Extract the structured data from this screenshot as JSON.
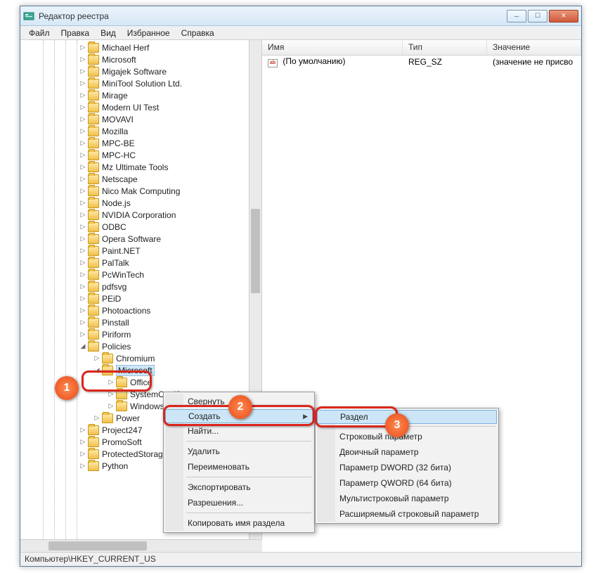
{
  "window": {
    "title": "Редактор реестра"
  },
  "menu": {
    "file": "Файл",
    "edit": "Правка",
    "view": "Вид",
    "favorites": "Избранное",
    "help": "Справка"
  },
  "tree": {
    "items": [
      {
        "indent": 84,
        "exp": "▷",
        "label": "Michael Herf"
      },
      {
        "indent": 84,
        "exp": "▷",
        "label": "Microsoft"
      },
      {
        "indent": 84,
        "exp": "▷",
        "label": "Migajek Software"
      },
      {
        "indent": 84,
        "exp": "▷",
        "label": "MiniTool Solution Ltd."
      },
      {
        "indent": 84,
        "exp": "▷",
        "label": "Mirage"
      },
      {
        "indent": 84,
        "exp": "▷",
        "label": "Modern UI Test"
      },
      {
        "indent": 84,
        "exp": "▷",
        "label": "MOVAVI"
      },
      {
        "indent": 84,
        "exp": "▷",
        "label": "Mozilla"
      },
      {
        "indent": 84,
        "exp": "▷",
        "label": "MPC-BE"
      },
      {
        "indent": 84,
        "exp": "▷",
        "label": "MPC-HC"
      },
      {
        "indent": 84,
        "exp": "▷",
        "label": "Mz Ultimate Tools"
      },
      {
        "indent": 84,
        "exp": "▷",
        "label": "Netscape"
      },
      {
        "indent": 84,
        "exp": "▷",
        "label": "Nico Mak Computing"
      },
      {
        "indent": 84,
        "exp": "▷",
        "label": "Node.js"
      },
      {
        "indent": 84,
        "exp": "▷",
        "label": "NVIDIA Corporation"
      },
      {
        "indent": 84,
        "exp": "▷",
        "label": "ODBC"
      },
      {
        "indent": 84,
        "exp": "▷",
        "label": "Opera Software"
      },
      {
        "indent": 84,
        "exp": "▷",
        "label": "Paint.NET"
      },
      {
        "indent": 84,
        "exp": "▷",
        "label": "PalTalk"
      },
      {
        "indent": 84,
        "exp": "▷",
        "label": "PcWinTech"
      },
      {
        "indent": 84,
        "exp": "▷",
        "label": "pdfsvg"
      },
      {
        "indent": 84,
        "exp": "▷",
        "label": "PEiD"
      },
      {
        "indent": 84,
        "exp": "▷",
        "label": "Photoactions"
      },
      {
        "indent": 84,
        "exp": "▷",
        "label": "Pinstall"
      },
      {
        "indent": 84,
        "exp": "▷",
        "label": "Piriform"
      },
      {
        "indent": 84,
        "exp": "◢",
        "label": "Policies"
      },
      {
        "indent": 104,
        "exp": "▷",
        "label": "Chromium"
      },
      {
        "indent": 104,
        "exp": "◢",
        "label": "Microsoft",
        "selected": true
      },
      {
        "indent": 124,
        "exp": "▷",
        "label": "Office"
      },
      {
        "indent": 124,
        "exp": "▷",
        "label": "SystemCertificates"
      },
      {
        "indent": 124,
        "exp": "▷",
        "label": "Windows"
      },
      {
        "indent": 104,
        "exp": "▷",
        "label": "Power"
      },
      {
        "indent": 84,
        "exp": "▷",
        "label": "Project247"
      },
      {
        "indent": 84,
        "exp": "▷",
        "label": "PromoSoft"
      },
      {
        "indent": 84,
        "exp": "▷",
        "label": "ProtectedStorage"
      },
      {
        "indent": 84,
        "exp": "▷",
        "label": "Python"
      }
    ]
  },
  "list": {
    "cols": {
      "name": "Имя",
      "type": "Тип",
      "value": "Значение"
    },
    "rows": [
      {
        "name": "(По умолчанию)",
        "type": "REG_SZ",
        "value": "(значение не присво"
      }
    ]
  },
  "statusbar": "Компьютер\\HKEY_CURRENT_US",
  "ctx1": {
    "collapse": "Свернуть",
    "new": "Создать",
    "find": "Найти...",
    "delete": "Удалить",
    "rename": "Переименовать",
    "export": "Экспортировать",
    "permissions": "Разрешения...",
    "copyKeyName": "Копировать имя раздела"
  },
  "ctx2": {
    "key": "Раздел",
    "string": "Строковый параметр",
    "binary": "Двоичный параметр",
    "dword": "Параметр DWORD (32 бита)",
    "qword": "Параметр QWORD (64 бита)",
    "multistring": "Мультистроковый параметр",
    "expandstring": "Расширяемый строковый параметр"
  },
  "callouts": {
    "1": "1",
    "2": "2",
    "3": "3"
  }
}
